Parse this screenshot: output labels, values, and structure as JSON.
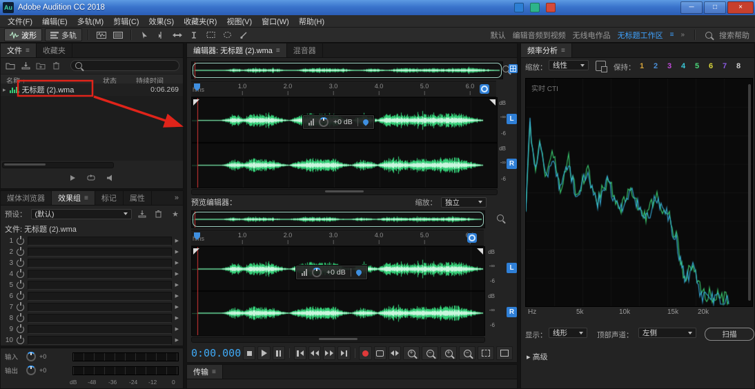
{
  "window": {
    "logo": "Au",
    "title": "Adobe Audition CC 2018"
  },
  "icons": {
    "panel_menu": "≡",
    "overflow": "»",
    "sort_up": "↑",
    "disclosure": "▸",
    "chevron_right": "▶",
    "star": "★",
    "minimize": "─",
    "maximize": "□",
    "close": "×",
    "advanced": "▸"
  },
  "menubar": {
    "items": [
      "文件(F)",
      "编辑(E)",
      "多轨(M)",
      "剪辑(C)",
      "效果(S)",
      "收藏夹(R)",
      "视图(V)",
      "窗口(W)",
      "帮助(H)"
    ]
  },
  "toolbar": {
    "waveform": "波形",
    "multitrack": "多轨",
    "workspaces": {
      "default": "默认",
      "edit_av": "编辑音频到视频",
      "radio": "无线电作品",
      "untitled": "无标题工作区"
    },
    "search": "搜索帮助"
  },
  "files": {
    "tab_files": "文件",
    "tab_favorites": "收藏夹",
    "col_name": "名称",
    "col_status": "状态",
    "col_duration": "持续时间",
    "row": {
      "name": "无标题 (2).wma",
      "duration": "0:06.269"
    }
  },
  "effects": {
    "tab_media": "媒体浏览器",
    "tab_rack": "效果组",
    "tab_markers": "标记",
    "tab_props": "属性",
    "preset_label": "预设：",
    "preset_value": "(默认)",
    "file_label": "文件:",
    "file_value": "无标题 (2).wma",
    "slots": [
      "1",
      "2",
      "3",
      "4",
      "5",
      "6",
      "7",
      "8",
      "9",
      "10"
    ]
  },
  "levels": {
    "input": "输入",
    "output": "输出",
    "gain": "+0",
    "scale": [
      "dB",
      "-48",
      "-36",
      "-24",
      "-12",
      "0"
    ]
  },
  "editor": {
    "tab_editor": "编辑器: 无标题 (2).wma",
    "tab_mixer": "混音器",
    "ruler_unit": "hms",
    "ticks": [
      "1.0",
      "2.0",
      "3.0",
      "4.0",
      "5.0",
      "6.0"
    ],
    "hud": "+0 dB",
    "scale_db": "dB",
    "scale_inf": "-∞",
    "scale_6": "-6",
    "ch_left": "L",
    "ch_right": "R",
    "preview_label": "预览编辑器：",
    "zoom_label": "缩放：",
    "zoom_value": "独立",
    "time": "0:00.000",
    "transport_tab": "传输"
  },
  "freq": {
    "title": "频率分析",
    "scale_label": "缩放：",
    "scale_value": "线性",
    "hold_label": "保持：",
    "hold_numbers": [
      "1",
      "2",
      "3",
      "4",
      "5",
      "6",
      "7",
      "8"
    ],
    "overlay": "实时 CTI",
    "axis": [
      "Hz",
      "5k",
      "10k",
      "15k",
      "20k"
    ],
    "display_label": "显示：",
    "display_value": "线形",
    "top_channel_label": "顶部声道：",
    "top_channel_value": "左侧",
    "scan": "扫描",
    "advanced": "高级"
  },
  "hold_colors": [
    "#d7a43a",
    "#4a8fd7",
    "#c04ad7",
    "#3ac8d7",
    "#4ad77a",
    "#d7d43a",
    "#8a5ae0",
    "#d0d0d0"
  ],
  "render": {
    "wave_color": "#35cf78",
    "wave_bright": "#c9f6dd",
    "envelope": [
      [
        0,
        0.01
      ],
      [
        0.08,
        0.01
      ],
      [
        0.1,
        0.08
      ],
      [
        0.13,
        0.3
      ],
      [
        0.16,
        0.12
      ],
      [
        0.19,
        0.34
      ],
      [
        0.22,
        0.28
      ],
      [
        0.26,
        0.3
      ],
      [
        0.29,
        0.1
      ],
      [
        0.32,
        0.02
      ],
      [
        0.36,
        0.26
      ],
      [
        0.4,
        0.38
      ],
      [
        0.44,
        0.3
      ],
      [
        0.48,
        0.34
      ],
      [
        0.51,
        0.1
      ],
      [
        0.54,
        0.02
      ],
      [
        0.57,
        0.28
      ],
      [
        0.6,
        0.22
      ],
      [
        0.63,
        0.05
      ],
      [
        0.66,
        0.3
      ],
      [
        0.7,
        0.36
      ],
      [
        0.74,
        0.22
      ],
      [
        0.78,
        0.34
      ],
      [
        0.82,
        0.28
      ],
      [
        0.86,
        0.32
      ],
      [
        0.9,
        0.4
      ],
      [
        0.94,
        0.26
      ],
      [
        0.97,
        0.12
      ],
      [
        1,
        0.03
      ]
    ],
    "spectrum": {
      "green": "#3fe07a",
      "cyan": "#38b6e8",
      "anchors": [
        [
          0,
          0.58
        ],
        [
          0.02,
          0.18
        ],
        [
          0.045,
          0.42
        ],
        [
          0.07,
          0.26
        ],
        [
          0.1,
          0.45
        ],
        [
          0.13,
          0.32
        ],
        [
          0.17,
          0.48
        ],
        [
          0.21,
          0.36
        ],
        [
          0.25,
          0.52
        ],
        [
          0.3,
          0.4
        ],
        [
          0.35,
          0.55
        ],
        [
          0.4,
          0.44
        ],
        [
          0.46,
          0.58
        ],
        [
          0.52,
          0.48
        ],
        [
          0.58,
          0.62
        ],
        [
          0.64,
          0.52
        ],
        [
          0.7,
          0.6
        ],
        [
          0.74,
          0.7
        ],
        [
          0.78,
          0.88
        ],
        [
          0.82,
          0.82
        ],
        [
          0.86,
          0.94
        ],
        [
          0.92,
          0.96
        ],
        [
          1,
          0.97
        ]
      ]
    }
  }
}
